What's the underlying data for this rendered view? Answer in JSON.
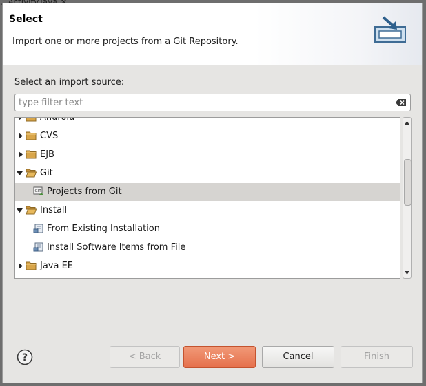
{
  "background_text": "...Activity.java ✕",
  "header": {
    "title": "Select",
    "description": "Import one or more projects from a Git Repository."
  },
  "source_label": "Select an import source:",
  "filter": {
    "placeholder": "type filter text"
  },
  "tree": {
    "items": [
      {
        "label": "Android",
        "type": "folder",
        "expanded": false
      },
      {
        "label": "CVS",
        "type": "folder",
        "expanded": false
      },
      {
        "label": "EJB",
        "type": "folder",
        "expanded": false
      },
      {
        "label": "Git",
        "type": "folder",
        "expanded": true
      },
      {
        "label": "Projects from Git",
        "type": "git-wizard",
        "selected": true
      },
      {
        "label": "Install",
        "type": "folder",
        "expanded": true
      },
      {
        "label": "From Existing Installation",
        "type": "install-wizard"
      },
      {
        "label": "Install Software Items from File",
        "type": "install-wizard"
      },
      {
        "label": "Java EE",
        "type": "folder",
        "expanded": false
      }
    ]
  },
  "buttons": {
    "help": "?",
    "back": "< Back",
    "next": "Next >",
    "cancel": "Cancel",
    "finish": "Finish"
  },
  "colors": {
    "primary_button": "#e5704c",
    "selection": "#d6d4d1",
    "dialog_bg": "#e6e5e3",
    "folder": "#d9a64a"
  }
}
